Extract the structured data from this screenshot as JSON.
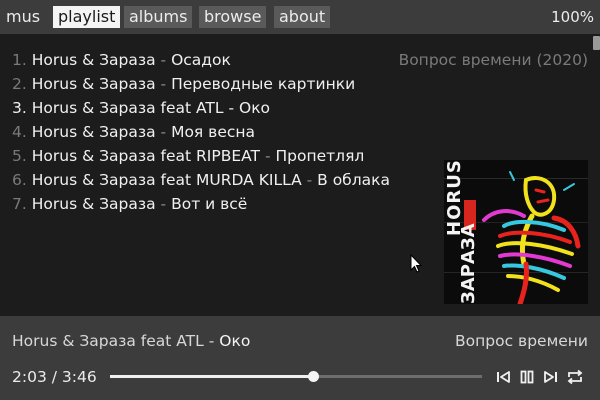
{
  "app": {
    "brand": "mus"
  },
  "nav": {
    "tabs": [
      {
        "label": "playlist",
        "active": true
      },
      {
        "label": "albums",
        "active": false
      },
      {
        "label": "browse",
        "active": false
      },
      {
        "label": "about",
        "active": false
      }
    ],
    "volume": "100%"
  },
  "playlist": {
    "album_title": "Вопрос времени (2020)",
    "tracks": [
      {
        "num": "1.",
        "artist": "Horus & Зараза",
        "sep": "-",
        "title": "Осадок",
        "current": false
      },
      {
        "num": "2.",
        "artist": "Horus & Зараза",
        "sep": "-",
        "title": "Переводные картинки",
        "current": false
      },
      {
        "num": "3.",
        "artist": "Horus & Зараза feat ATL",
        "sep": "-",
        "title": "Око",
        "current": true
      },
      {
        "num": "4.",
        "artist": "Horus & Зараза",
        "sep": "-",
        "title": "Моя весна",
        "current": false
      },
      {
        "num": "5.",
        "artist": "Horus & Зараза feat RIPBEAT",
        "sep": "-",
        "title": "Пропетлял",
        "current": false
      },
      {
        "num": "6.",
        "artist": "Horus & Зараза feat MURDA KILLA",
        "sep": "-",
        "title": "В облака",
        "current": false
      },
      {
        "num": "7.",
        "artist": "Horus & Зараза",
        "sep": "-",
        "title": "Вот и всё",
        "current": false
      }
    ],
    "cover": {
      "artist_text": "HORUS",
      "title_text": "ЗАРАЗА"
    }
  },
  "player": {
    "artist": "Horus & Зараза feat ATL",
    "sep": "-",
    "title": "Око",
    "album": "Вопрос времени",
    "elapsed": "2:03",
    "time_sep": "/",
    "duration": "3:46",
    "progress": 0.545,
    "controls": [
      "prev-icon",
      "pause-icon",
      "next-icon",
      "repeat-icon"
    ]
  },
  "colors": {
    "bar_bg": "#3c3c3c",
    "content_bg": "#1c1c1c",
    "active_tab_bg": "#f4f4f4",
    "muted_text": "#7a7a7a"
  }
}
